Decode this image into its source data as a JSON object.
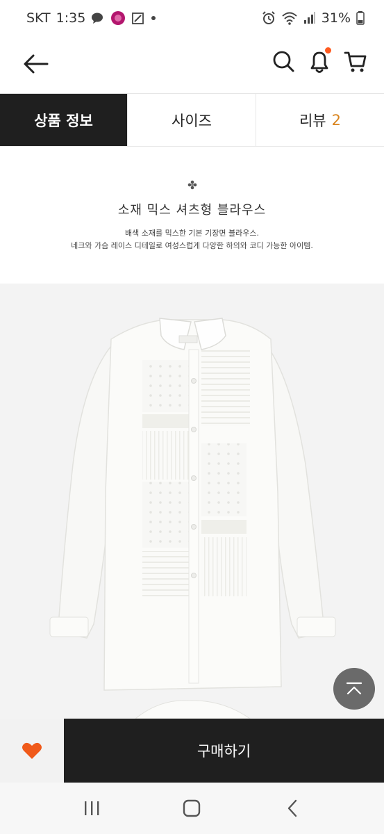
{
  "status_bar": {
    "carrier": "SKT",
    "time": "1:35",
    "battery": "31%"
  },
  "header": {
    "back_icon": "arrow-left-icon",
    "search_icon": "search-icon",
    "notification_icon": "bell-icon",
    "cart_icon": "cart-icon"
  },
  "tabs": [
    {
      "label": "상품 정보",
      "active": true
    },
    {
      "label": "사이즈",
      "active": false
    },
    {
      "label": "리뷰",
      "count": "2",
      "active": false
    }
  ],
  "intro": {
    "title": "소재 믹스 셔츠형 블라우스",
    "desc_line1": "배색 소재를 믹스한 기본 기장면 블라우스.",
    "desc_line2": "네크와 가슴 레이스 디테일로 여성스럽게 다양한 하의와 코디 가능한 아이템."
  },
  "colors": {
    "accent_orange": "#ff5a1f",
    "review_count": "#d9841e",
    "dark": "#1f1f1f"
  },
  "actions": {
    "wish_icon": "heart-icon",
    "buy_label": "구매하기",
    "scroll_top_icon": "scroll-top-icon"
  },
  "nav": {
    "recents_icon": "recents-icon",
    "home_icon": "home-icon",
    "back_icon": "back-icon"
  }
}
